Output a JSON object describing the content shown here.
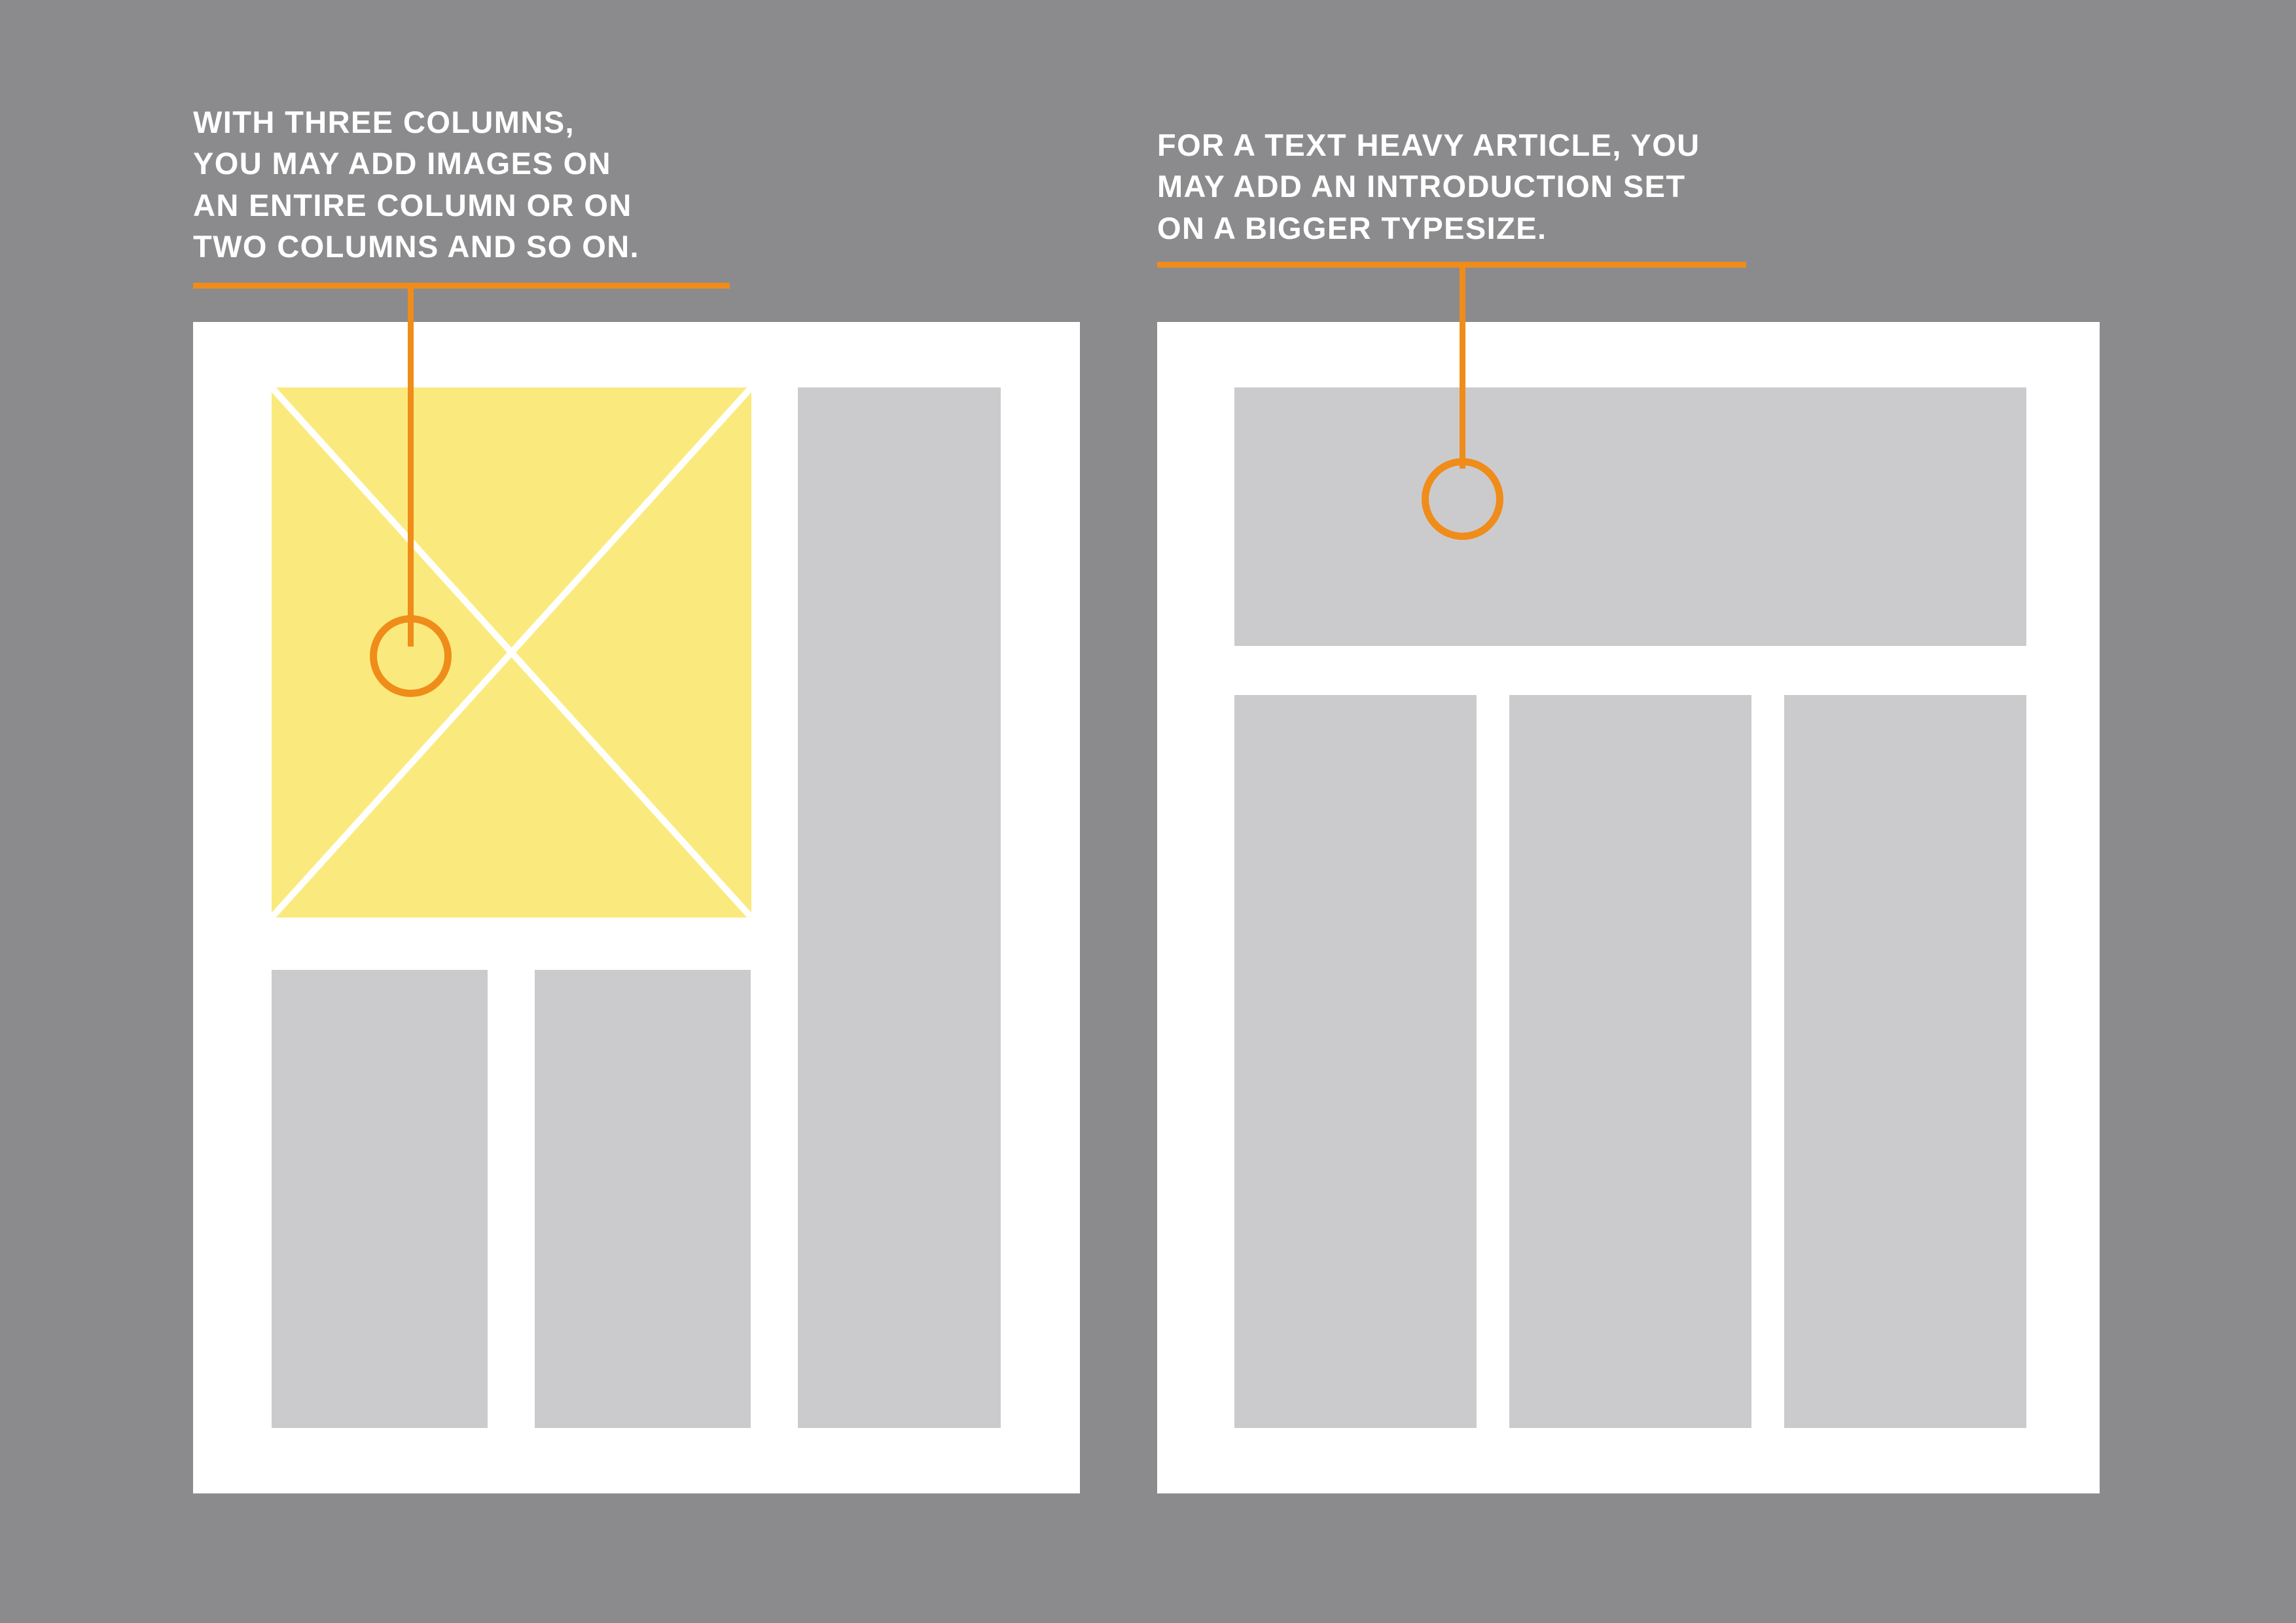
{
  "colors": {
    "background": "#8b8b8d",
    "page": "#ffffff",
    "block": "#cbcbcd",
    "image_placeholder": "#faea7d",
    "accent": "#f08c1a",
    "caption_text": "#ffffff"
  },
  "left": {
    "caption": "With three columns,\nyou may add images on\nan entire column or on\ntwo columns and so on."
  },
  "right": {
    "caption": "For a text heavy article, you\nmay add an introduction set\non a bigger typesize."
  }
}
